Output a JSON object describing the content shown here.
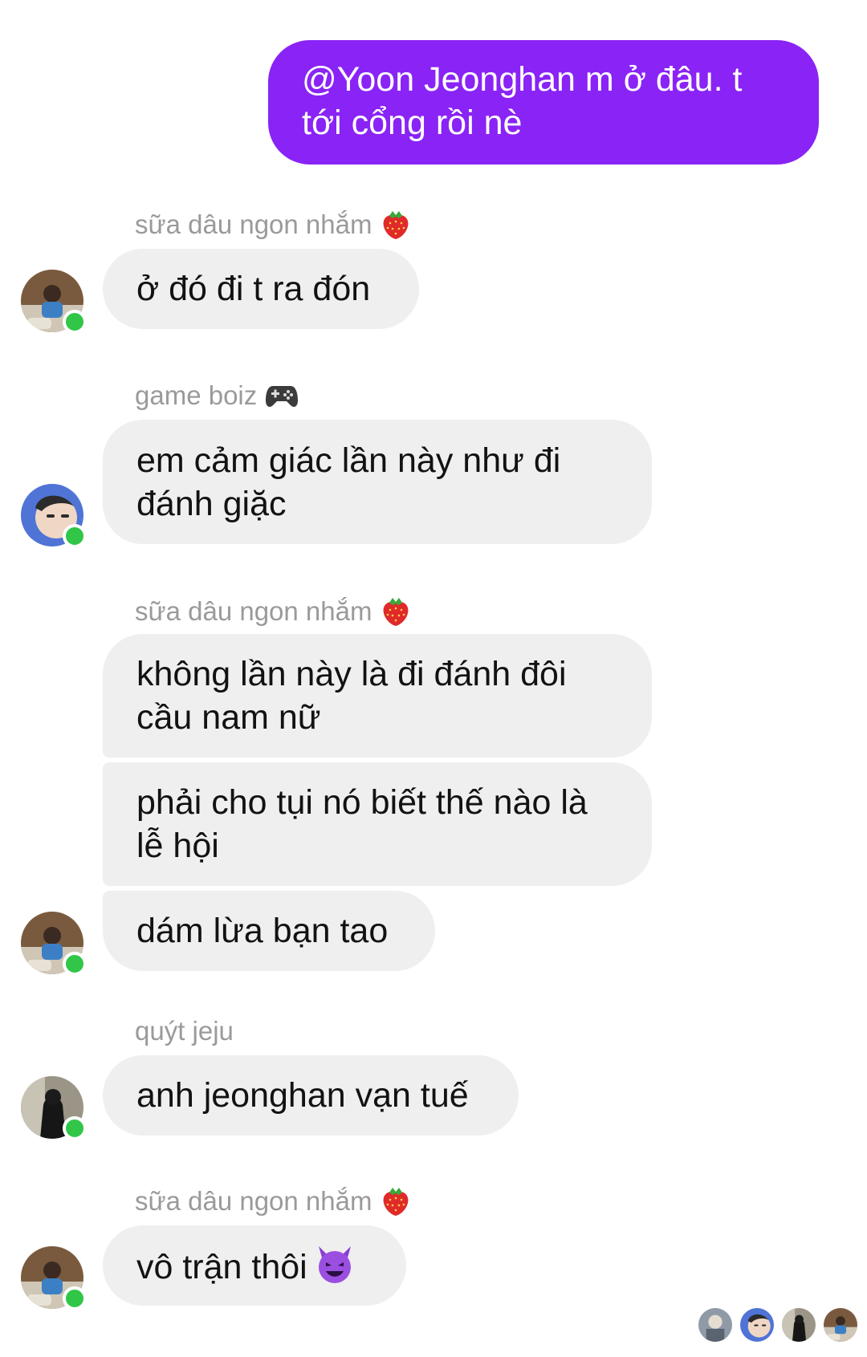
{
  "outgoing": {
    "text": "@Yoon Jeonghan m ở đâu. t tới cổng rồi nè",
    "color": "#8a23f5"
  },
  "groups": [
    {
      "sender": "sữa dâu ngon nhắm",
      "sender_icon": "strawberry-icon",
      "messages": [
        "ở đó đi t ra đón"
      ]
    },
    {
      "sender": "game boiz",
      "sender_icon": "game-controller-icon",
      "messages": [
        "em cảm giác lần này như đi đánh giặc"
      ]
    },
    {
      "sender": "sữa dâu ngon nhắm",
      "sender_icon": "strawberry-icon",
      "messages": [
        "không lần này là đi đánh đôi cầu nam nữ",
        "phải cho tụi nó biết thế nào là lễ hội",
        "dám lừa bạn tao"
      ]
    },
    {
      "sender": "quýt jeju",
      "sender_icon": "",
      "messages": [
        "anh jeonghan vạn tuế"
      ]
    },
    {
      "sender": "sữa dâu ngon nhắm",
      "sender_icon": "strawberry-icon",
      "messages": [
        "vô trận thôi"
      ],
      "trailing_icon": "smiling-devil-icon"
    }
  ],
  "colors": {
    "incoming_bubble": "#efefef",
    "online": "#31c648",
    "sender_text": "#9a9a9a"
  }
}
